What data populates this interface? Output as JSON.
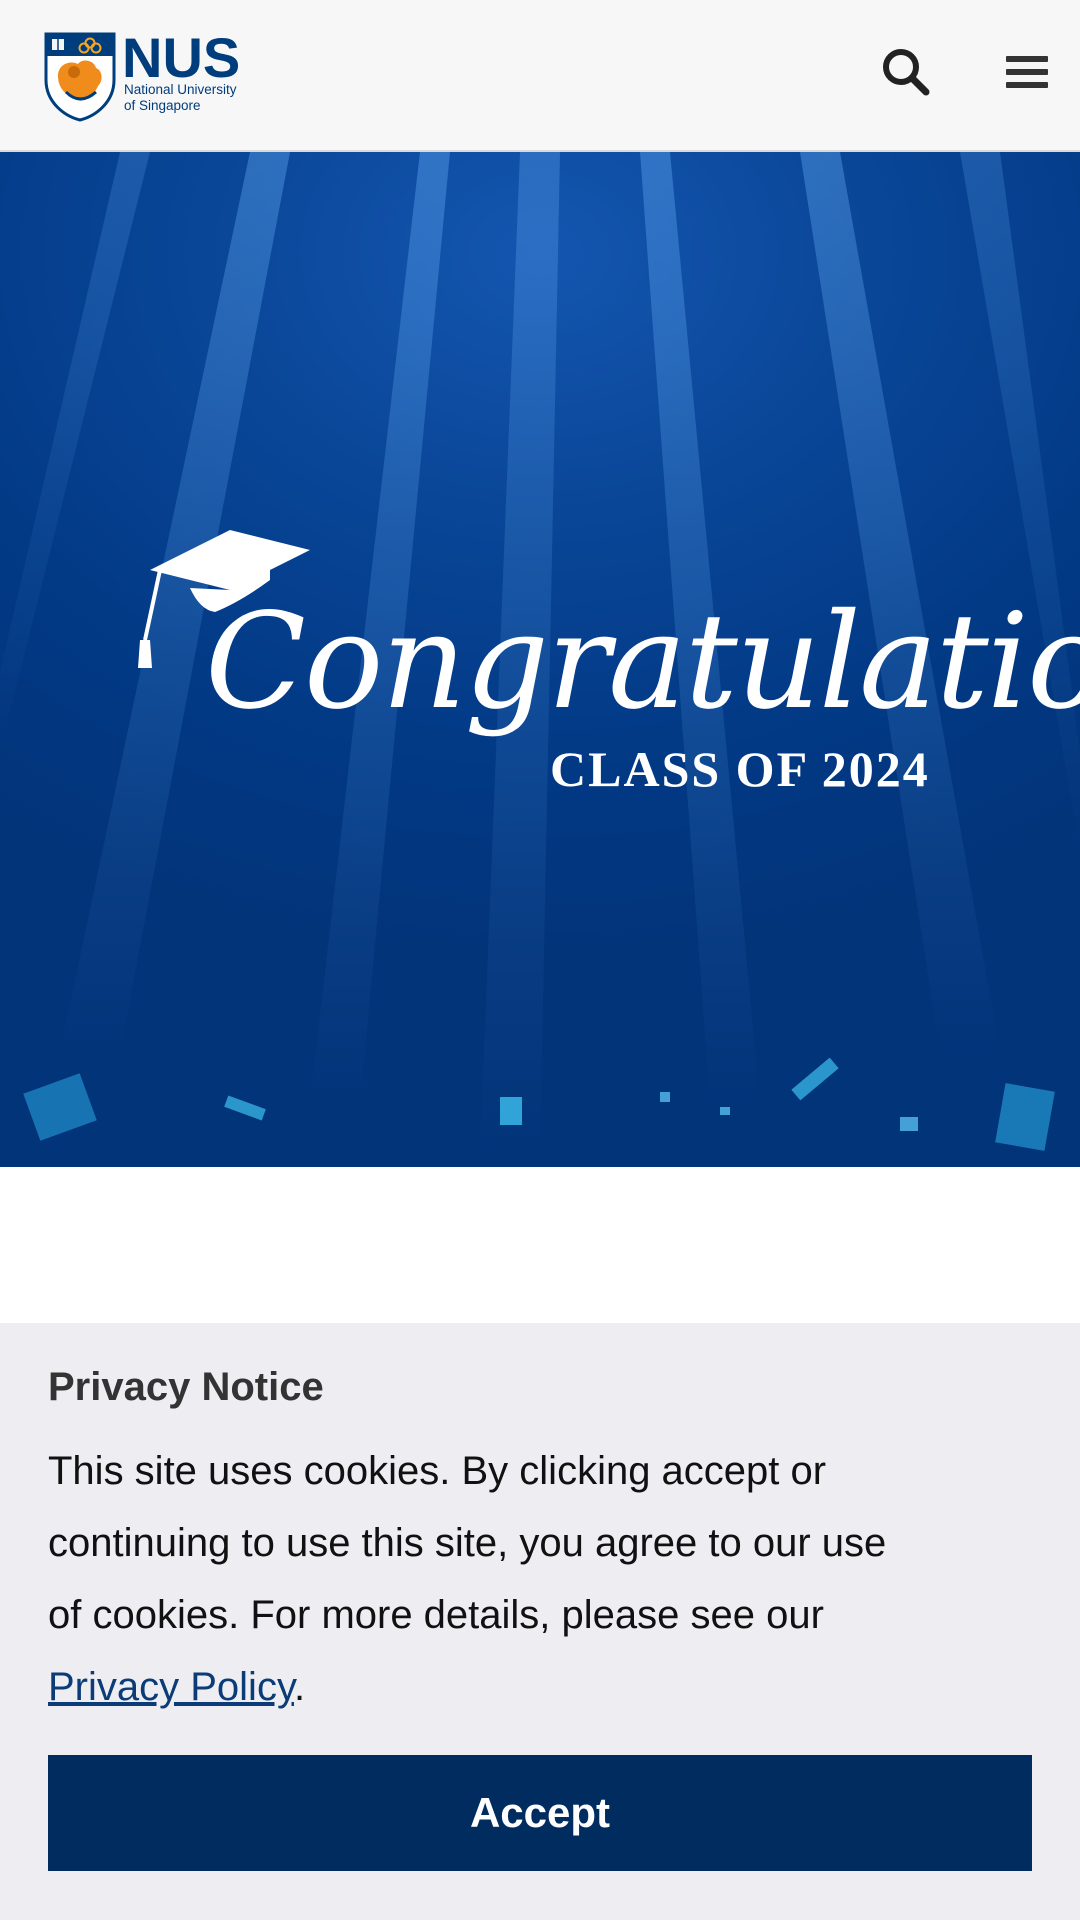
{
  "header": {
    "brand_name": "NUS",
    "brand_subtitle_line1": "National University",
    "brand_subtitle_line2": "of Singapore",
    "search_icon": "search-icon",
    "menu_icon": "hamburger-menu-icon"
  },
  "hero": {
    "headline": "Congratulations",
    "subline": "CLASS OF 2024",
    "decoration_icon": "graduation-cap-icon",
    "colors": {
      "background": "#023a86",
      "text": "#ffffff"
    }
  },
  "cookie_banner": {
    "title": "Privacy Notice",
    "body_text": "This site uses cookies. By clicking accept or continuing to use this site, you agree to our use of cookies. For more details, please see our ",
    "link_text": "Privacy Policy",
    "trailing_text": ".",
    "accept_label": "Accept",
    "colors": {
      "background": "#eeeef2",
      "button": "#002c5f",
      "link": "#0b3c78"
    }
  }
}
